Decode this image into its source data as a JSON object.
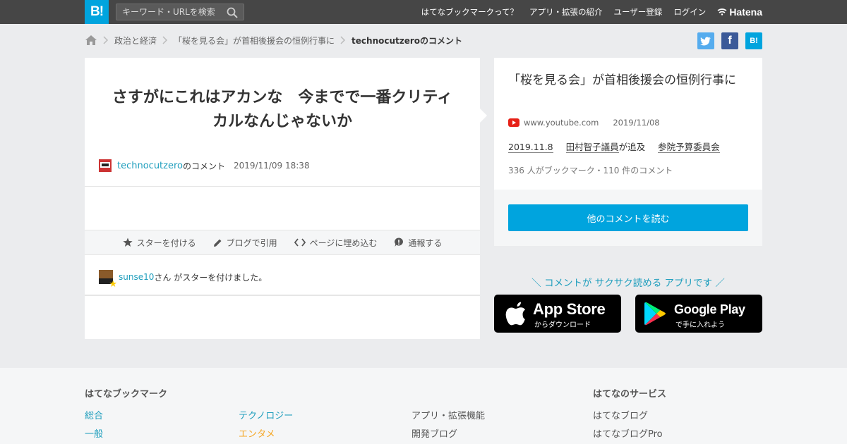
{
  "header": {
    "logo_text": "B!",
    "search_placeholder": "キーワード・URLを検索",
    "nav": [
      "はてなブックマークって？",
      "アプリ・拡張の紹介",
      "ユーザー登録",
      "ログイン"
    ],
    "brand": "Hatena"
  },
  "breadcrumb": {
    "items": [
      "政治と経済",
      "「桜を見る会」が首相後援会の恒例行事に"
    ],
    "current": "technocutzeroのコメント"
  },
  "share": {
    "twitter": "t",
    "facebook": "f",
    "hatebu": "B!"
  },
  "comment": {
    "text": "さすがにこれはアカンな　今までで一番クリティカルなんじゃないか",
    "user": "technocutzero",
    "user_suffix": "のコメント",
    "datetime": "2019/11/09 18:38"
  },
  "actions": {
    "star": "スターを付ける",
    "blog": "ブログで引用",
    "embed": "ページに埋め込む",
    "report": "通報する"
  },
  "stars": {
    "user": "sunse10",
    "text": "さん がスターを付けました。"
  },
  "entry": {
    "title": "「桜を見る会」が首相後援会の恒例行事に",
    "domain": "www.youtube.com",
    "date": "2019/11/08",
    "desc_date": "2019.11.8",
    "desc_person": "田村智子議員",
    "desc_mid": "が追及",
    "desc_committee": "参院予算委員会",
    "count": "336 人がブックマーク・110 件のコメント",
    "read_button": "他のコメントを読む"
  },
  "apps": {
    "tagline": "＼ コメントが サクサク読める アプリです ／",
    "appstore_big": "App Store",
    "appstore_small": "からダウンロード",
    "gplay_big": "Google Play",
    "gplay_small": "で手に入れよう"
  },
  "footer": {
    "col1_heading": "はてなブックマーク",
    "col1": [
      "総合",
      "一般"
    ],
    "col2": [
      "テクノロジー",
      "エンタメ"
    ],
    "col3": [
      "アプリ・拡張機能",
      "開発ブログ"
    ],
    "col4_heading": "はてなのサービス",
    "col4": [
      "はてなブログ",
      "はてなブログPro"
    ]
  }
}
